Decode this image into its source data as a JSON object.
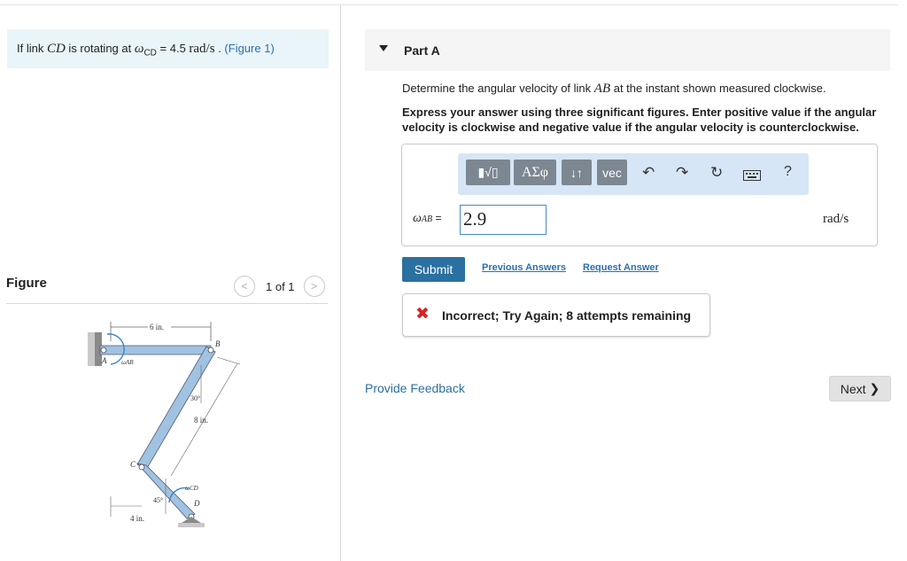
{
  "problem": {
    "prefix": "If link ",
    "link_var": "CD",
    "mid": " is rotating at ",
    "omega": "ω",
    "omega_sub": "CD",
    "equals": " = 4.5 ",
    "units": "rad/s",
    "after": " . ",
    "figure_link": "(Figure 1)"
  },
  "figure": {
    "title": "Figure",
    "pager_count": "1 of 1",
    "prev_icon": "chevron-left-icon",
    "next_icon": "chevron-right-icon",
    "labels": {
      "dim_top": "6 in.",
      "B": "B",
      "A": "A",
      "omega_ab": "ωAB",
      "angle30": "30°",
      "dim_mid": "8 in.",
      "C": "C",
      "omega_cd": "ωCD",
      "angle45": "45°",
      "D": "D",
      "dim_bottom": "4 in."
    }
  },
  "part": {
    "title": "Part A",
    "question_pre": "Determine the angular velocity of link ",
    "question_var": "AB",
    "question_post": " at the instant shown measured clockwise.",
    "instructions": "Express your answer using three significant figures. Enter positive value if the angular velocity is clockwise and negative value if the angular velocity is counterclockwise."
  },
  "toolbar": {
    "template_label": "▮√▯",
    "greek_label": "ΑΣφ",
    "arrows_label": "↓↑",
    "vec_label": "vec",
    "undo_icon": "undo-icon",
    "redo_icon": "redo-icon",
    "reset_icon": "reset-icon",
    "keyboard_icon": "keyboard-icon",
    "help_label": "?"
  },
  "answer": {
    "omega": "ω",
    "sub": "AB",
    "equals": " =",
    "value": "2.9",
    "units": "rad/s"
  },
  "actions": {
    "submit": "Submit",
    "previous_answers": "Previous Answers",
    "request_answer": "Request Answer"
  },
  "feedback": {
    "icon": "✖",
    "message": "Incorrect; Try Again; 8 attempts remaining"
  },
  "footer": {
    "provide_feedback": "Provide Feedback",
    "next": "Next",
    "next_icon": "❯"
  },
  "colors": {
    "accent": "#2a70a0",
    "problem_bg": "#e9f5f8",
    "toolbar_bg": "#d6e6f6",
    "error": "#dd2222"
  }
}
